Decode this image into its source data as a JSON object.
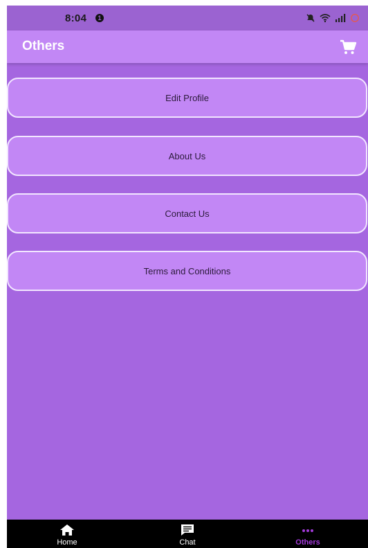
{
  "status_bar": {
    "time": "8:04",
    "notification_count": "1"
  },
  "app_bar": {
    "title": "Others",
    "cart_icon": "cart-icon"
  },
  "menu": {
    "items": [
      {
        "label": "Edit Profile"
      },
      {
        "label": "About Us"
      },
      {
        "label": "Contact Us"
      },
      {
        "label": "Terms and Conditions"
      }
    ]
  },
  "bottom_nav": {
    "items": [
      {
        "label": "Home",
        "icon": "home-icon",
        "active": false
      },
      {
        "label": "Chat",
        "icon": "chat-icon",
        "active": false
      },
      {
        "label": "Others",
        "icon": "more-icon",
        "active": true
      }
    ]
  },
  "colors": {
    "background": "#a566e0",
    "app_bar": "#c287f5",
    "menu_item": "#c287f5",
    "menu_border": "#f2e6ff",
    "nav_background": "#000000",
    "nav_active": "#a23ad9"
  }
}
